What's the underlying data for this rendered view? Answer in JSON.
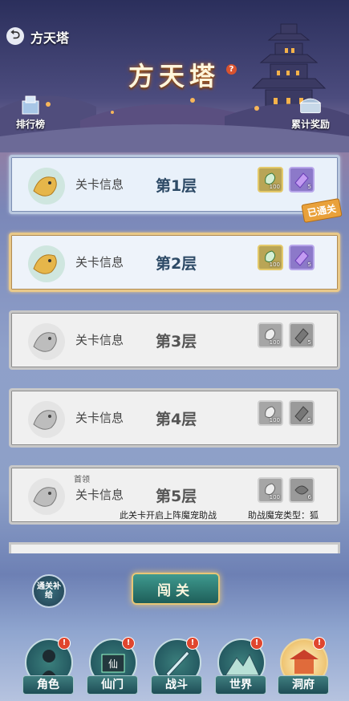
{
  "header": {
    "back_label": "方天塔",
    "title": "方天塔",
    "help": "?",
    "rank_label": "排行榜",
    "reward_label": "累计奖励"
  },
  "floors": [
    {
      "info": "关卡信息",
      "floor": "第1层",
      "state": "passed",
      "passed_label": "已通关",
      "reward1_count": "100",
      "reward2_count": "5"
    },
    {
      "info": "关卡信息",
      "floor": "第2层",
      "state": "current",
      "reward1_count": "100",
      "reward2_count": "5"
    },
    {
      "info": "关卡信息",
      "floor": "第3层",
      "state": "locked",
      "reward1_count": "100",
      "reward2_count": "5"
    },
    {
      "info": "关卡信息",
      "floor": "第4层",
      "state": "locked",
      "reward1_count": "100",
      "reward2_count": "5"
    },
    {
      "info": "关卡信息",
      "floor": "第5层",
      "state": "locked",
      "reward1_count": "100",
      "reward2_count": "6",
      "first_tag": "首领",
      "hint_left": "此关卡开启上阵魔宠助战",
      "hint_right": "助战魔宠类型：狐"
    }
  ],
  "actions": {
    "supply_label": "通关补给",
    "challenge_label": "闯关"
  },
  "dock": [
    {
      "label": "角色",
      "badge": "!"
    },
    {
      "label": "仙门",
      "badge": "!",
      "emblem": "仙"
    },
    {
      "label": "战斗",
      "badge": "!"
    },
    {
      "label": "世界",
      "badge": "!"
    },
    {
      "label": "洞府",
      "badge": "!"
    }
  ]
}
